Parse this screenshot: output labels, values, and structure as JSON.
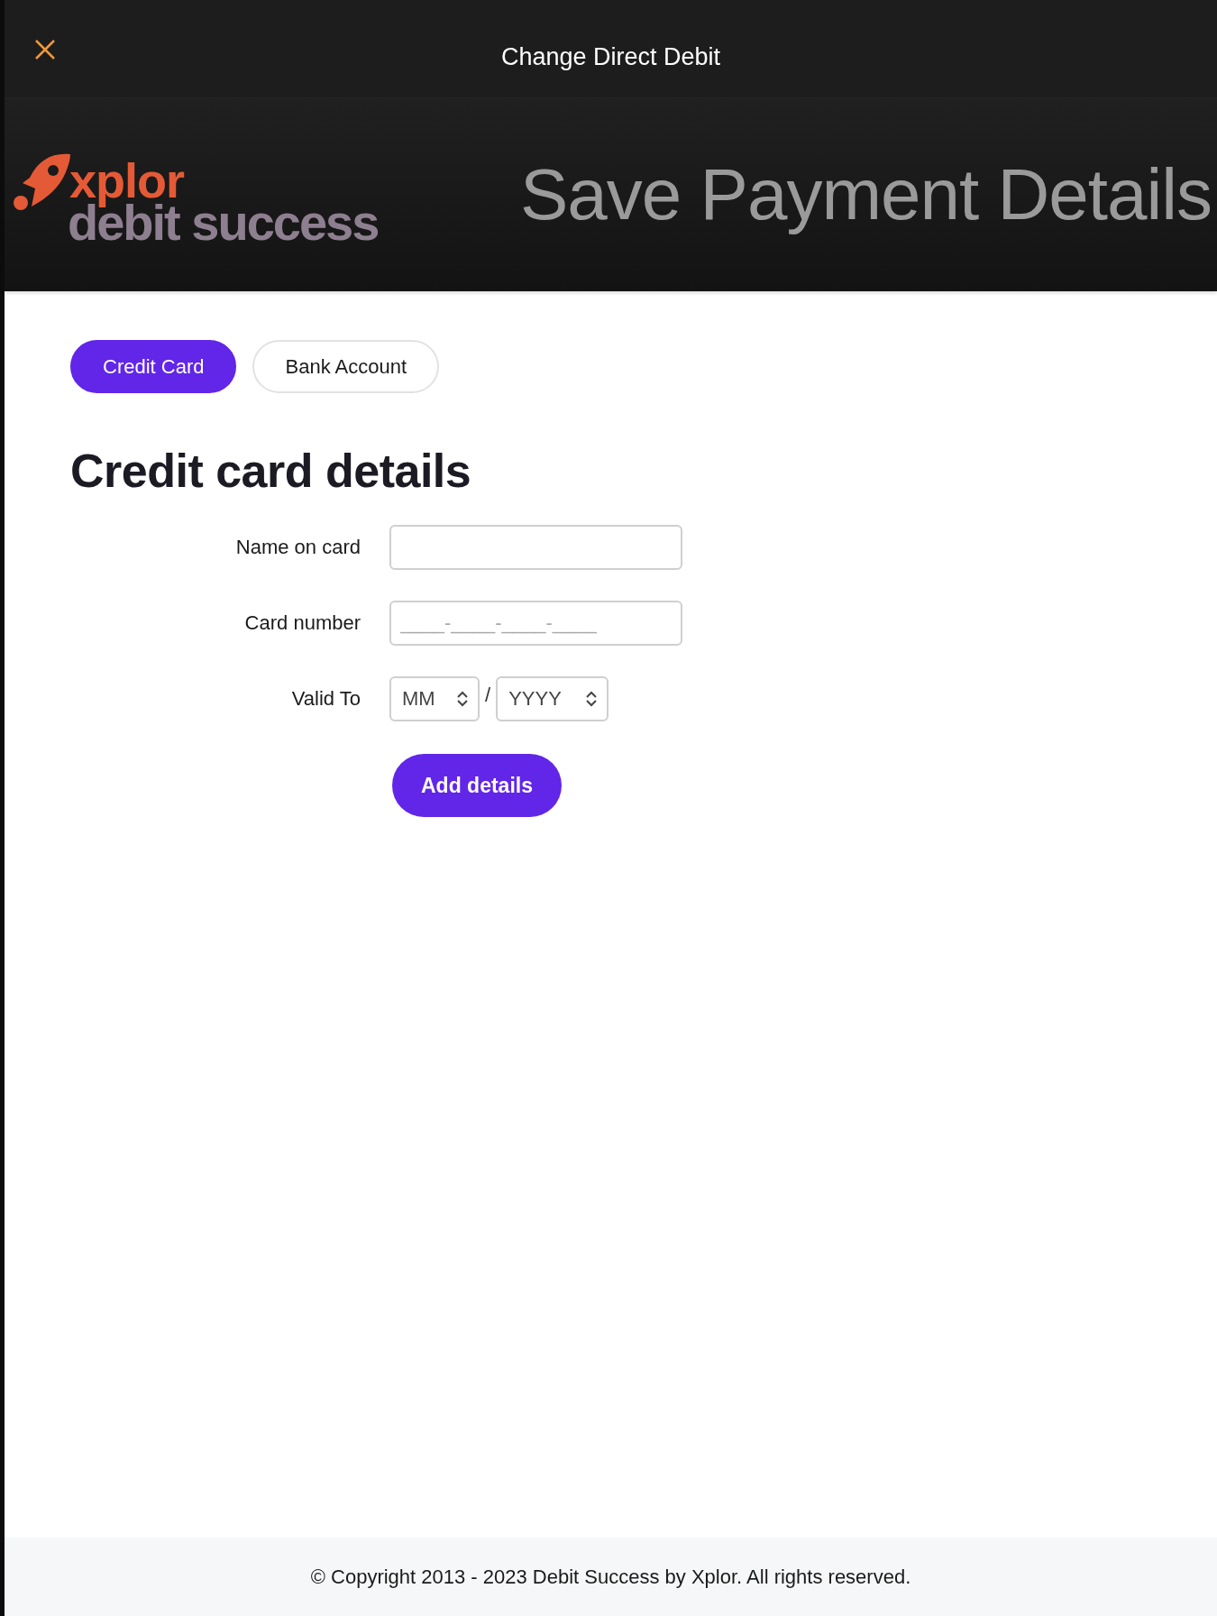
{
  "top_bar": {
    "title": "Change Direct Debit"
  },
  "header": {
    "logo": {
      "brand": "xplor",
      "product": "debit success"
    },
    "title": "Save Payment Details"
  },
  "tabs": [
    {
      "label": "Credit Card",
      "selected": true
    },
    {
      "label": "Bank Account",
      "selected": false
    }
  ],
  "form": {
    "heading": "Credit card details",
    "fields": [
      {
        "kind": "text",
        "label": "Name on card"
      },
      {
        "kind": "text",
        "label": "Card number",
        "placeholder": "____-____-____-____"
      },
      {
        "kind": "expiry",
        "label": "Valid To",
        "month": "MM",
        "separator": "/",
        "year": "YYYY"
      }
    ],
    "submit": "Add details"
  },
  "footer": {
    "text": "© Copyright 2013 - 2023 Debit Success by Xplor. All rights reserved."
  }
}
